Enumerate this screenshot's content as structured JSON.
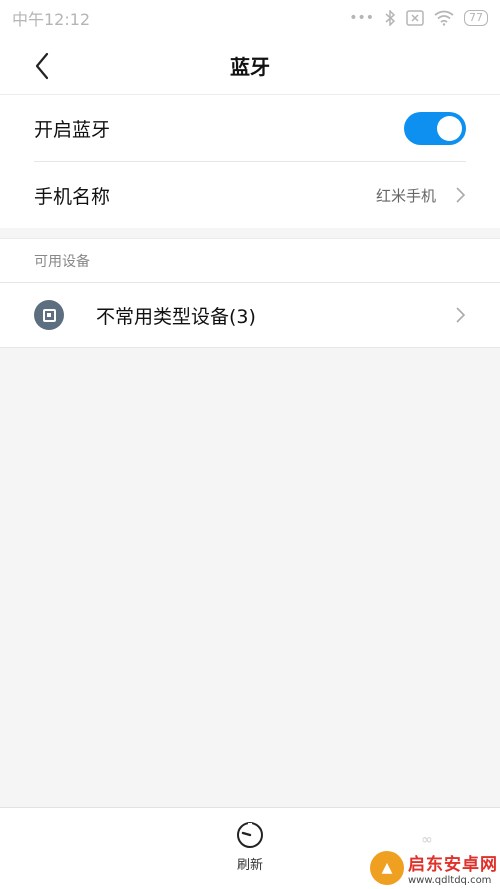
{
  "status_bar": {
    "time": "中午12:12",
    "dots": "•••",
    "battery": "77"
  },
  "header": {
    "title": "蓝牙"
  },
  "settings": {
    "bluetooth_toggle_label": "开启蓝牙",
    "bluetooth_enabled": true,
    "device_name_label": "手机名称",
    "device_name_value": "红米手机"
  },
  "available": {
    "section_title": "可用设备",
    "devices": [
      {
        "label": "不常用类型设备(3)",
        "icon": "device-generic-icon"
      }
    ]
  },
  "bottom_bar": {
    "refresh_label": "刷新",
    "more_glyph": "∞"
  },
  "watermark": {
    "title": "启东安卓网",
    "url": "www.qdltdq.com"
  },
  "colors": {
    "accent": "#0e90f0",
    "device_icon": "#5c6e80",
    "background": "#f5f5f5"
  }
}
